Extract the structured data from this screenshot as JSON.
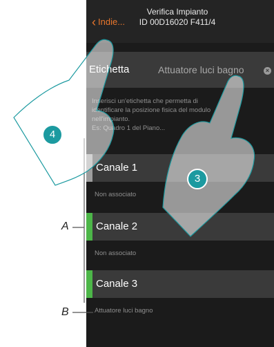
{
  "header": {
    "back_label": "Indie...",
    "title_line1": "Verifica Impianto",
    "title_line2": "ID 00D16020 F411/4"
  },
  "label_field": {
    "title": "Etichetta",
    "value": "Attuatore luci bagno"
  },
  "hint": {
    "line1": "Inserisci un'etichetta che permetta di",
    "line2": "identificare la posizione fisica del modulo",
    "line3": "nell'impianto.",
    "line4": "Es: Quadro 1 del Piano..."
  },
  "channels": [
    {
      "name": "Canale 1",
      "status": "Non associato",
      "color": "#9e9e9e"
    },
    {
      "name": "Canale 2",
      "status": "Non associato",
      "color": "#4cb648"
    },
    {
      "name": "Canale 3",
      "status": "Attuatore luci bagno",
      "color": "#4cb648"
    }
  ],
  "annotations": {
    "step_a": "4",
    "step_b": "3",
    "callout_a": "A",
    "callout_b": "B"
  },
  "colors": {
    "accent": "#e8762c",
    "badge": "#1c9aa0",
    "associated": "#4cb648"
  }
}
